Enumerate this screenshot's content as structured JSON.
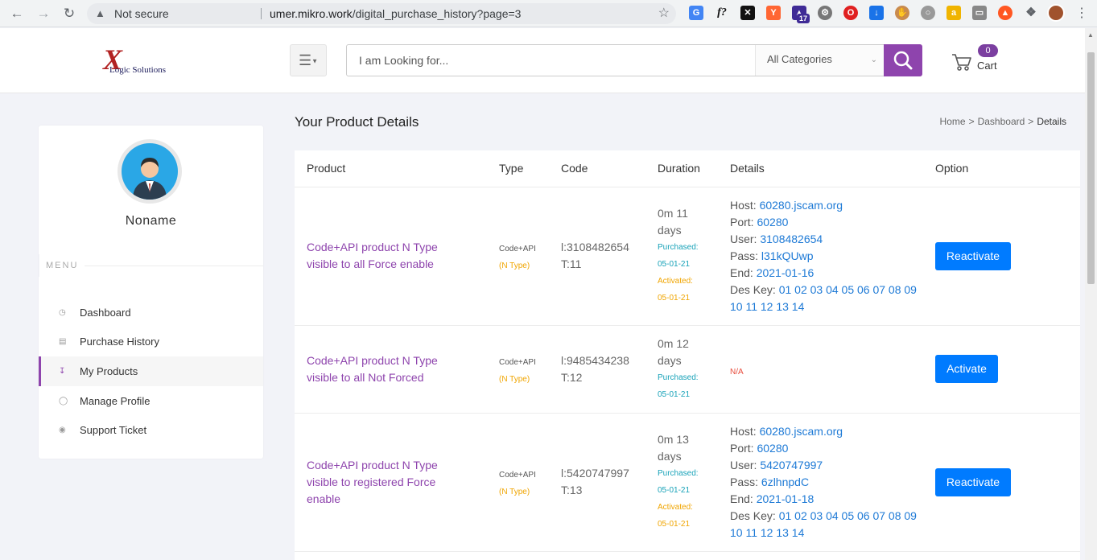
{
  "browser": {
    "not_secure": "Not secure",
    "url_host": "umer.mikro.work",
    "url_path": "/digital_purchase_history?page=3",
    "ext_badge": "17"
  },
  "header": {
    "logo_text": "Logic Solutions",
    "search_placeholder": "I am Looking for...",
    "category": "All Categories",
    "cart_count": "0",
    "cart_label": "Cart"
  },
  "sidebar": {
    "user_name": "Noname",
    "menu_label": "MENU",
    "items": [
      {
        "label": "Dashboard"
      },
      {
        "label": "Purchase History"
      },
      {
        "label": "My Products"
      },
      {
        "label": "Manage Profile"
      },
      {
        "label": "Support Ticket"
      }
    ]
  },
  "main": {
    "title": "Your Product Details",
    "breadcrumb": {
      "home": "Home",
      "dashboard": "Dashboard",
      "current": "Details",
      "sep": ">"
    },
    "columns": [
      "Product",
      "Type",
      "Code",
      "Duration",
      "Details",
      "Option"
    ],
    "rows": [
      {
        "product": "Code+API product N Type visible to all Force enable",
        "type": "Code+API",
        "type_sub": "(N Type)",
        "code_l": "l:3108482654",
        "code_t": "T:11",
        "duration": "0m 11 days",
        "purchased_label": "Purchased:",
        "purchased_date": "05-01-21",
        "activated_label": "Activated:",
        "activated_date": "05-01-21",
        "host_label": "Host:",
        "host": "60280.jscam.org",
        "port_label": "Port:",
        "port": "60280",
        "user_label": "User:",
        "user": "3108482654",
        "pass_label": "Pass:",
        "pass": "l31kQUwp",
        "end_label": "End:",
        "end": "2021-01-16",
        "deskey_label": "Des Key:",
        "deskey": "01 02 03 04 05 06 07 08 09 10 11 12 13 14",
        "option": "Reactivate"
      },
      {
        "product": "Code+API product N Type visible to all Not Forced",
        "type": "Code+API",
        "type_sub": "(N Type)",
        "code_l": "l:9485434238",
        "code_t": "T:12",
        "duration": "0m 12 days",
        "purchased_label": "Purchased:",
        "purchased_date": "05-01-21",
        "details_na": "N/A",
        "option": "Activate"
      },
      {
        "product": "Code+API product N Type visible to registered Force enable",
        "type": "Code+API",
        "type_sub": "(N Type)",
        "code_l": "l:5420747997",
        "code_t": "T:13",
        "duration": "0m 13 days",
        "purchased_label": "Purchased:",
        "purchased_date": "05-01-21",
        "activated_label": "Activated:",
        "activated_date": "05-01-21",
        "host_label": "Host:",
        "host": "60280.jscam.org",
        "port_label": "Port:",
        "port": "60280",
        "user_label": "User:",
        "user": "5420747997",
        "pass_label": "Pass:",
        "pass": "6zlhnpdC",
        "end_label": "End:",
        "end": "2021-01-18",
        "deskey_label": "Des Key:",
        "deskey": "01 02 03 04 05 06 07 08 09 10 11 12 13 14",
        "option": "Reactivate"
      }
    ]
  },
  "colors": {
    "accent": "#8e44ad",
    "button": "#007bff",
    "link": "#1e7ad6",
    "purchased": "#17a2b8",
    "activated": "#f0a500",
    "na": "#e74c3c"
  }
}
